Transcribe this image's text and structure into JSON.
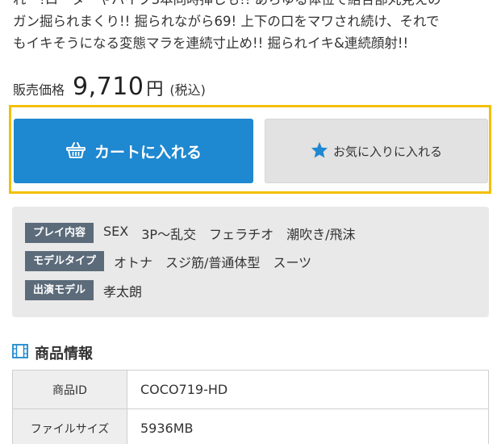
{
  "description": "れ゛!ローターやバイブ3本同時挿しも!! あらゆる体位で結合部丸見えの\nガン掘られまくり!! 掘られながら69! 上下の口をマワされ続け、それで\nもイキそうになる変態マラを連続寸止め!! 掘られイキ&連続顔射!!",
  "price": {
    "label": "販売価格",
    "value": "9,710",
    "unit": "円",
    "tax": "(税込)"
  },
  "buttons": {
    "cart_label": "カートに入れる",
    "cart_icon": "basket-icon",
    "favorite_label": "お気に入りに入れる",
    "favorite_icon": "star-icon"
  },
  "colors": {
    "cart_button": "#1e88d0",
    "frame_highlight": "#f3bf00",
    "star": "#1e88d0",
    "tag_label_bg": "#5c6b7a"
  },
  "tags": [
    {
      "label": "プレイ内容",
      "values": [
        "SEX",
        "3P〜乱交",
        "フェラチオ",
        "潮吹き/飛沫"
      ]
    },
    {
      "label": "モデルタイプ",
      "values": [
        "オトナ",
        "スジ筋/普通体型",
        "スーツ"
      ]
    },
    {
      "label": "出演モデル",
      "values": [
        "孝太朗"
      ]
    }
  ],
  "product_info": {
    "title": "商品情報",
    "icon": "film-icon",
    "rows": [
      {
        "key": "商品ID",
        "value": "COCO719-HD"
      },
      {
        "key": "ファイルサイズ",
        "value": "5936MB"
      }
    ]
  }
}
